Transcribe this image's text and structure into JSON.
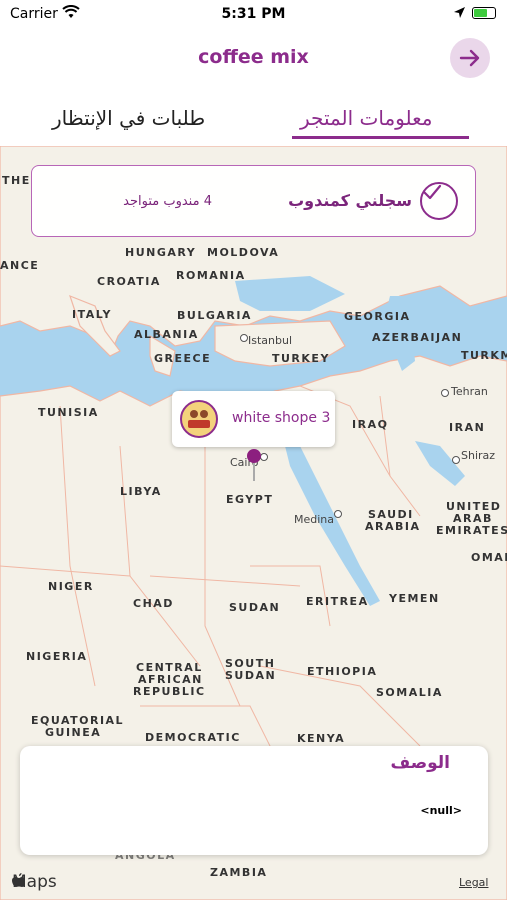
{
  "status_bar": {
    "carrier": "Carrier",
    "time": "5:31 PM",
    "battery_percent": 72
  },
  "nav": {
    "title": "coffee mix",
    "back_icon": "arrow-right-icon"
  },
  "tabs": [
    {
      "label": "معلومات المتجر",
      "active": true
    },
    {
      "label": "طلبات في الإنتظار",
      "active": false
    }
  ],
  "delegate_card": {
    "register_label": "سجلني كمندوب",
    "count_text": "4 مندوب متواجد"
  },
  "map": {
    "labels": [
      "THE",
      "ANCE",
      "HUNGARY",
      "MOLDOVA",
      "ROMANIA",
      "CROATIA",
      "ITALY",
      "BULGARIA",
      "ALBANIA",
      "GREECE",
      "GEORGIA",
      "AZERBAIJAN",
      "TURKM",
      "TURKEY",
      "TUNISIA",
      "IRAQ",
      "IRAN",
      "LIBYA",
      "EGYPT",
      "SAUDI",
      "ARABIA",
      "UNITED",
      "ARAB",
      "EMIRATES",
      "OMAN",
      "NIGER",
      "CHAD",
      "SUDAN",
      "ERITREA",
      "YEMEN",
      "NIGERIA",
      "CENTRAL",
      "AFRICAN",
      "REPUBLIC",
      "SOUTH",
      "SUDAN",
      "ETHIOPIA",
      "SOMALIA",
      "EQUATORIAL",
      "GUINEA",
      "DEMOCRATIC",
      "KENYA",
      "ANGOLA",
      "ZAMBIA"
    ],
    "cities": [
      "Istanbul",
      "Tehran",
      "Shiraz",
      "Cairo",
      "Medina"
    ],
    "marker_name": "white shope 3"
  },
  "description": {
    "label": "الوصف",
    "value": "<null>"
  },
  "footer": {
    "maps_label": "Maps",
    "legal_label": "Legal"
  },
  "colors": {
    "brand": "#8c2c8c",
    "water": "#a9d3ee",
    "land": "#f4f1e8"
  }
}
